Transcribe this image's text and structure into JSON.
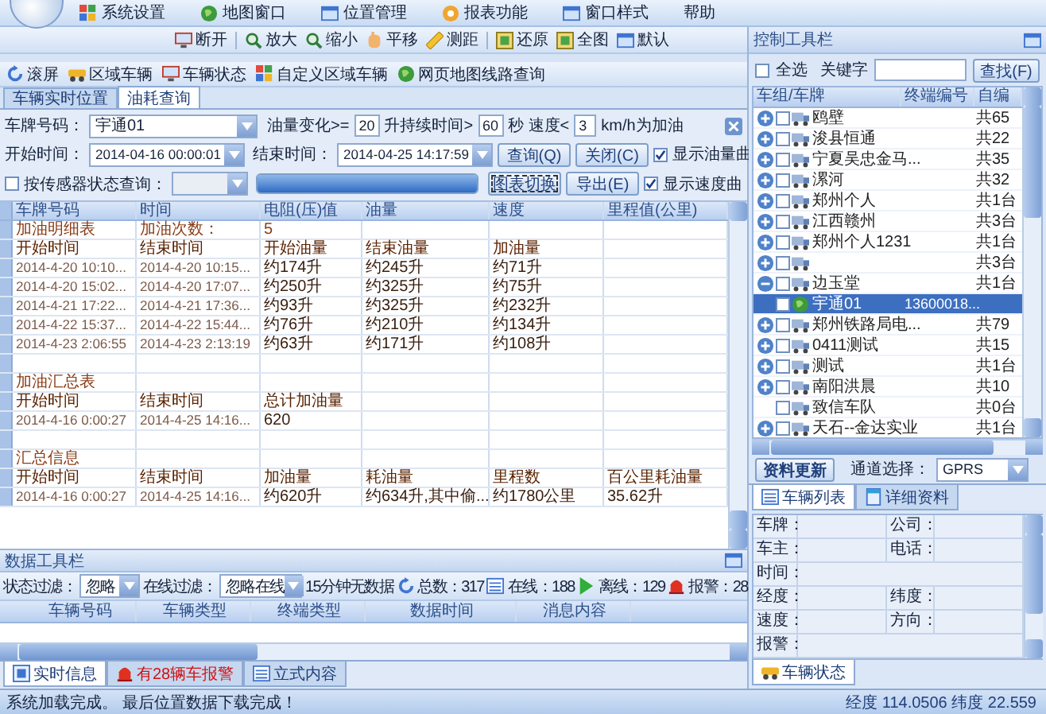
{
  "menu": [
    "系统设置",
    "地图窗口",
    "位置管理",
    "报表功能",
    "窗口样式",
    "帮助"
  ],
  "map_toolbar": [
    "断开",
    "放大",
    "缩小",
    "平移",
    "测距",
    "还原",
    "全图",
    "默认"
  ],
  "tool_links": [
    "滚屏",
    "区域车辆",
    "车辆状态",
    "自定义区域车辆",
    "网页地图线路查询"
  ],
  "tabs": [
    {
      "label": "车辆实时位置",
      "selected": false
    },
    {
      "label": "油耗查询",
      "selected": true
    }
  ],
  "query": {
    "plate_label": "车牌号码：",
    "plate": "宇通01",
    "fuel_change_label": "油量变化>=",
    "fuel_change": "20",
    "duration_label": "升持续时间>",
    "duration": "60",
    "speed_label": "秒 速度<",
    "speed": "3",
    "speed_unit": "km/h为加油",
    "start_label": "开始时间：",
    "start": "2014-04-16 00:00:01",
    "end_label": "结束时间：",
    "end": "2014-04-25 14:17:59",
    "sensor": {
      "label": "按传感器状态查询：",
      "checked": false
    },
    "progress": {
      "level": 1
    },
    "buttons": [
      {
        "label": "查询(Q)",
        "focused": false
      },
      {
        "label": "关闭(C)",
        "focused": false
      },
      {
        "label": "图表切换",
        "focused": true
      },
      {
        "label": "导出(E)",
        "focused": false
      }
    ],
    "curves": [
      {
        "label": "显示油量曲",
        "checked": true
      },
      {
        "label": "显示速度曲",
        "checked": true
      }
    ]
  },
  "table": {
    "columns": [
      "车牌号码",
      "时间",
      "电阻(压)值",
      "油量",
      "速度",
      "里程值(公里)"
    ],
    "rows": [
      {
        "kind": "section",
        "cells": [
          "加油明细表",
          "加油次数：",
          "5"
        ]
      },
      {
        "kind": "header",
        "cells": [
          "开始时间",
          "结束时间",
          "开始油量",
          "结束油量",
          "加油量"
        ]
      },
      {
        "kind": "data",
        "cells": [
          "2014-4-20 10:10...",
          "2014-4-20 10:15...",
          "约174升",
          "约245升",
          "约71升"
        ]
      },
      {
        "kind": "data",
        "cells": [
          "2014-4-20 15:02...",
          "2014-4-20 17:07...",
          "约250升",
          "约325升",
          "约75升"
        ]
      },
      {
        "kind": "data",
        "cells": [
          "2014-4-21 17:22...",
          "2014-4-21 17:36...",
          "约93升",
          "约325升",
          "约232升"
        ]
      },
      {
        "kind": "data",
        "cells": [
          "2014-4-22 15:37...",
          "2014-4-22 15:44...",
          "约76升",
          "约210升",
          "约134升"
        ]
      },
      {
        "kind": "data",
        "cells": [
          "2014-4-23 2:06:55",
          "2014-4-23 2:13:19",
          "约63升",
          "约171升",
          "约108升"
        ]
      },
      {
        "kind": "blank"
      },
      {
        "kind": "section",
        "cells": [
          "加油汇总表"
        ]
      },
      {
        "kind": "header",
        "cells": [
          "开始时间",
          "结束时间",
          "总计加油量"
        ]
      },
      {
        "kind": "data",
        "cells": [
          "2014-4-16 0:00:27",
          "2014-4-25 14:16...",
          "620"
        ]
      },
      {
        "kind": "blank"
      },
      {
        "kind": "section",
        "cells": [
          "汇总信息"
        ]
      },
      {
        "kind": "header",
        "cells": [
          "开始时间",
          "结束时间",
          "加油量",
          "耗油量",
          "里程数",
          "百公里耗油量"
        ]
      },
      {
        "kind": "data",
        "cells": [
          "2014-4-16 0:00:27",
          "2014-4-25 14:16...",
          "约620升",
          "约634升,其中偷...",
          "约1780公里",
          "35.62升"
        ]
      }
    ]
  },
  "data_toolbar": {
    "title": "数据工具栏",
    "status_label": "状态过滤：",
    "status": "忽略",
    "online_label": "在线过滤：",
    "online": "忽略在线",
    "no_data": "15分钟无数据",
    "counts": [
      {
        "kind": "total",
        "label": "总数：317"
      },
      {
        "kind": "online",
        "label": "在线：188"
      },
      {
        "kind": "offline",
        "label": "离线：129"
      },
      {
        "kind": "alarm",
        "label": "报警：28"
      }
    ],
    "columns": [
      "车辆号码",
      "车辆类型",
      "终端类型",
      "数据时间",
      "消息内容"
    ],
    "tabs": [
      {
        "kind": "info",
        "label": "实时信息",
        "selected": true
      },
      {
        "kind": "alarm",
        "label": "有28辆车报警",
        "selected": false
      },
      {
        "kind": "list",
        "label": "立式内容",
        "selected": false
      }
    ]
  },
  "control": {
    "title": "控制工具栏",
    "select_all": {
      "label": "全选",
      "checked": false
    },
    "keyword_label": "关键字",
    "find": "查找(F)",
    "columns": [
      "车组/车牌",
      "终端编号",
      "自编"
    ],
    "groups": [
      {
        "kind": "group",
        "name": "鸥壁",
        "count": "共65",
        "expanded": false,
        "checked": false,
        "selected": false
      },
      {
        "kind": "group",
        "name": "浚县恒通",
        "count": "共22",
        "expanded": false,
        "checked": false,
        "selected": false
      },
      {
        "kind": "group",
        "name": "宁夏吴忠金马...",
        "count": "共35",
        "expanded": false,
        "checked": false,
        "selected": false
      },
      {
        "kind": "group",
        "name": "漯河",
        "count": "共32",
        "expanded": false,
        "checked": false,
        "selected": false
      },
      {
        "kind": "group",
        "name": "郑州个人",
        "count": "共1台",
        "expanded": false,
        "checked": false,
        "selected": false
      },
      {
        "kind": "group",
        "name": "江西赣州",
        "count": "共3台",
        "expanded": false,
        "checked": false,
        "selected": false
      },
      {
        "kind": "group",
        "name": "郑州个人1231",
        "count": "共1台",
        "expanded": false,
        "checked": false,
        "selected": false
      },
      {
        "kind": "group",
        "count": "共3台",
        "expanded": false,
        "checked": false,
        "selected": false
      },
      {
        "kind": "group",
        "name": "边玉堂",
        "count": "共1台",
        "expanded": true,
        "checked": false,
        "selected": false,
        "children": [
          {
            "name": "宇通01",
            "terminal": "13600018...",
            "checked": false,
            "selected": true
          }
        ]
      },
      {
        "kind": "group",
        "name": "郑州铁路局电...",
        "count": "共79",
        "expanded": false,
        "checked": false,
        "selected": false
      },
      {
        "kind": "group",
        "name": "0411测试",
        "count": "共15",
        "expanded": false,
        "checked": false,
        "selected": false
      },
      {
        "kind": "group",
        "name": "测试",
        "count": "共1台",
        "expanded": false,
        "checked": false,
        "selected": false
      },
      {
        "kind": "group",
        "name": "南阳洪晨",
        "count": "共10",
        "expanded": false,
        "checked": false,
        "selected": false
      },
      {
        "kind": "empty",
        "name": "致信车队",
        "count": "共0台",
        "checked": false,
        "selected": false
      },
      {
        "kind": "group",
        "name": "天石--金达实业",
        "count": "共1台",
        "expanded": false,
        "checked": false,
        "selected": false
      }
    ],
    "update": "资料更新",
    "channel_label": "通道选择：",
    "channel": "GPRS",
    "tabs": [
      {
        "kind": "list",
        "label": "车辆列表",
        "selected": true
      },
      {
        "kind": "doc",
        "label": "详细资料",
        "selected": false
      }
    ],
    "details": [
      [
        "车牌：",
        "公司："
      ],
      [
        "车主：",
        "电话："
      ],
      [
        "时间："
      ],
      [
        "经度：",
        "纬度："
      ],
      [
        "速度：",
        "方向："
      ],
      [
        "报警："
      ]
    ],
    "bottom_tab": "车辆状态"
  },
  "status": {
    "message": "系统加载完成。 最后位置数据下载完成！",
    "coords": "经度 114.0506 纬度 22.559"
  }
}
